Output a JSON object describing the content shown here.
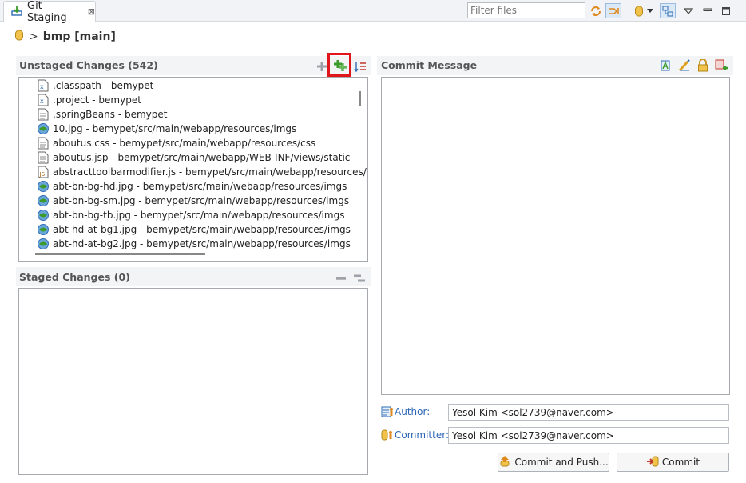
{
  "view": {
    "tab_label": "Git Staging",
    "close_glyph": "⊠"
  },
  "toolbar": {
    "filter_placeholder": "Filter files",
    "icons": [
      "synchronize-icon",
      "link-selection-icon",
      "repository-icon",
      "dropdown-arrow-icon",
      "layout-icon",
      "view-menu-icon",
      "minimize-icon",
      "maximize-icon"
    ]
  },
  "repo": {
    "separator": ">",
    "name": "bmp [main]"
  },
  "unstaged": {
    "title": "Unstaged Changes (542)",
    "files": [
      {
        "icon": "xml-file-icon",
        "text": ".classpath - bemypet"
      },
      {
        "icon": "xml-file-icon",
        "text": ".project - bemypet"
      },
      {
        "icon": "text-file-icon",
        "text": ".springBeans - bemypet"
      },
      {
        "icon": "image-file-icon",
        "text": "10.jpg - bemypet/src/main/webapp/resources/imgs"
      },
      {
        "icon": "text-file-icon",
        "text": "aboutus.css - bemypet/src/main/webapp/resources/css"
      },
      {
        "icon": "text-file-icon",
        "text": "aboutus.jsp - bemypet/src/main/webapp/WEB-INF/views/static"
      },
      {
        "icon": "js-file-icon",
        "text": "abstracttoolbarmodifier.js - bemypet/src/main/webapp/resources/ckeditor"
      },
      {
        "icon": "image-file-icon",
        "text": "abt-bn-bg-hd.jpg - bemypet/src/main/webapp/resources/imgs"
      },
      {
        "icon": "image-file-icon",
        "text": "abt-bn-bg-sm.jpg - bemypet/src/main/webapp/resources/imgs"
      },
      {
        "icon": "image-file-icon",
        "text": "abt-bn-bg-tb.jpg - bemypet/src/main/webapp/resources/imgs"
      },
      {
        "icon": "image-file-icon",
        "text": "abt-hd-at-bg1.jpg - bemypet/src/main/webapp/resources/imgs"
      },
      {
        "icon": "image-file-icon",
        "text": "abt-hd-at-bg2.jpg - bemypet/src/main/webapp/resources/imgs"
      }
    ]
  },
  "staged": {
    "title": "Staged Changes (0)"
  },
  "commit": {
    "title": "Commit Message",
    "message": "",
    "author_label": "Author:",
    "author_value": "Yesol Kim <sol2739@naver.com>",
    "committer_label": "Committer:",
    "committer_value": "Yesol Kim <sol2739@naver.com>",
    "commit_push_label": "Commit and Push...",
    "commit_label": "Commit"
  },
  "colors": {
    "highlight": "#e0161b",
    "accent_green": "#3a9a2a",
    "link_blue": "#2a64b4"
  }
}
